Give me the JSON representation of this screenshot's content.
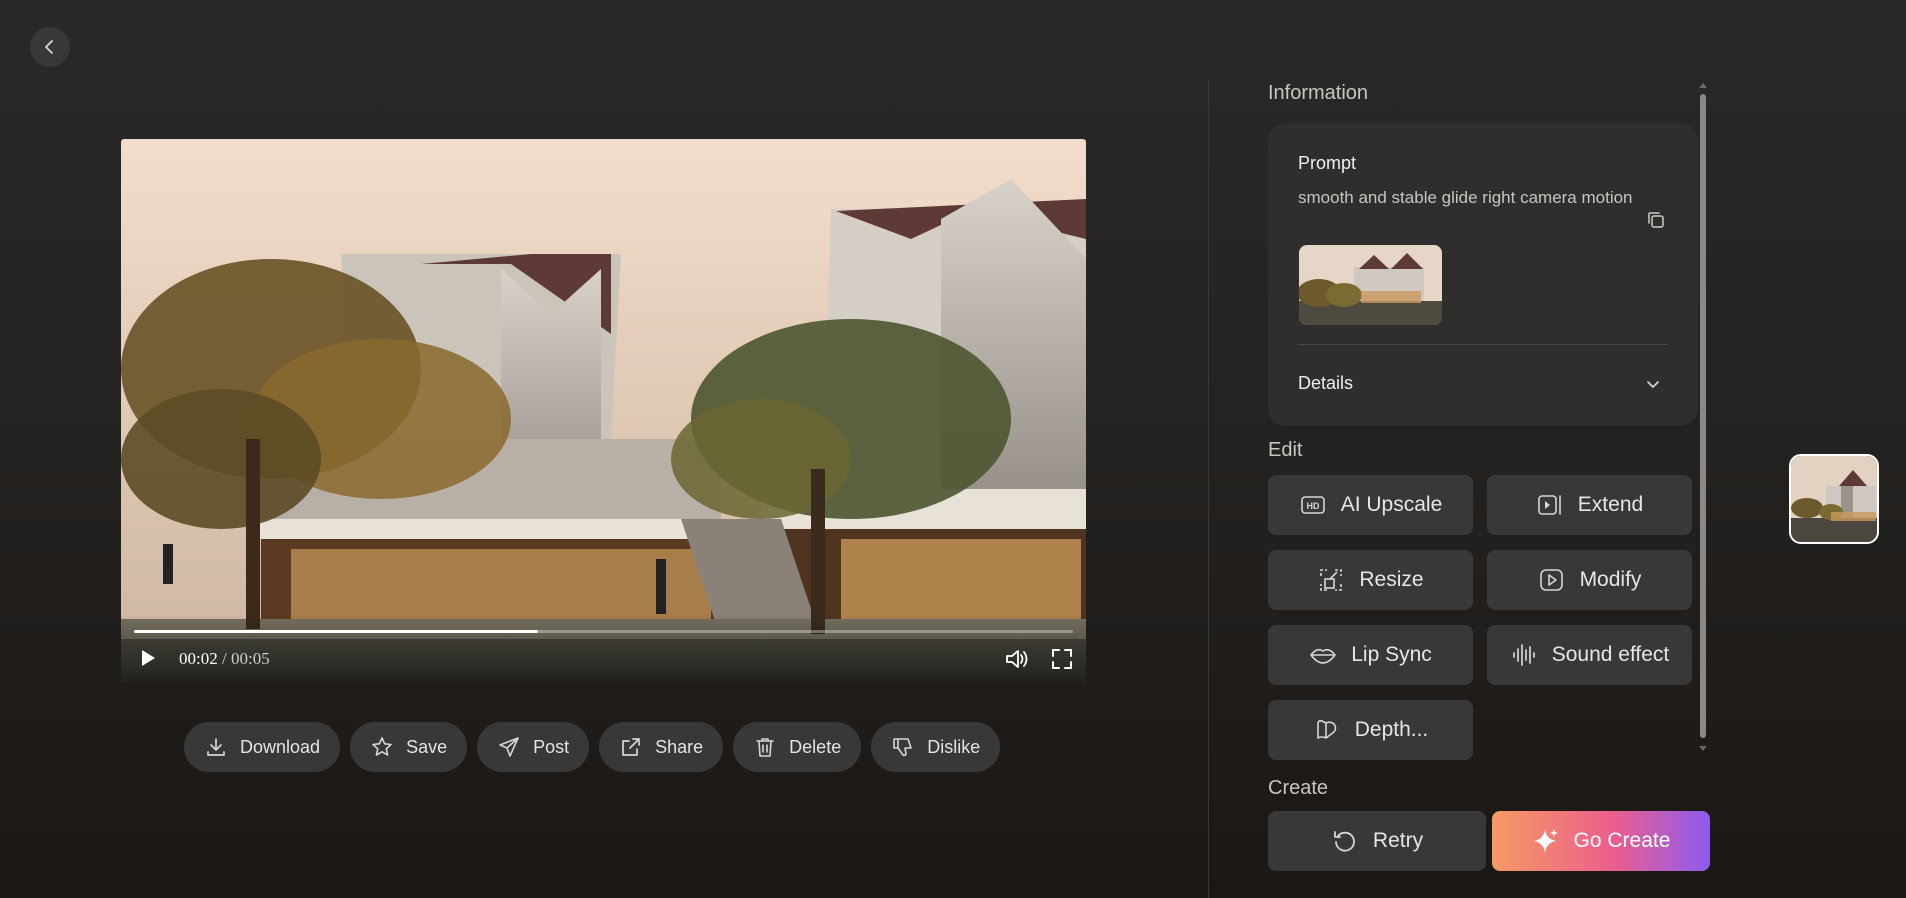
{
  "nav": {
    "back_icon": "chevron-left-icon"
  },
  "player": {
    "current_time": "00:02",
    "separator": " / ",
    "total_time": "00:05",
    "progress": 0.43,
    "icons": [
      "play-icon",
      "volume-icon",
      "fullscreen-icon"
    ]
  },
  "actions": [
    {
      "id": "download",
      "label": "Download",
      "icon": "download-icon"
    },
    {
      "id": "save",
      "label": "Save",
      "icon": "star-icon"
    },
    {
      "id": "post",
      "label": "Post",
      "icon": "send-icon"
    },
    {
      "id": "share",
      "label": "Share",
      "icon": "share-icon"
    },
    {
      "id": "delete",
      "label": "Delete",
      "icon": "trash-icon"
    },
    {
      "id": "dislike",
      "label": "Dislike",
      "icon": "thumbs-down-icon"
    }
  ],
  "info": {
    "title": "Information",
    "prompt_label": "Prompt",
    "prompt_text": "smooth and stable glide right camera motion",
    "details_label": "Details"
  },
  "edit": {
    "title": "Edit",
    "buttons": [
      {
        "id": "ai-upscale",
        "label": "AI Upscale",
        "icon": "hd-icon"
      },
      {
        "id": "extend",
        "label": "Extend",
        "icon": "extend-icon"
      },
      {
        "id": "resize",
        "label": "Resize",
        "icon": "resize-icon"
      },
      {
        "id": "modify",
        "label": "Modify",
        "icon": "modify-video-icon"
      },
      {
        "id": "lip-sync",
        "label": "Lip Sync",
        "icon": "lips-icon"
      },
      {
        "id": "sound-effect",
        "label": "Sound effect",
        "icon": "sound-wave-icon"
      },
      {
        "id": "depth",
        "label": "Depth...",
        "icon": "depth-icon"
      }
    ]
  },
  "create": {
    "title": "Create",
    "retry_label": "Retry",
    "go_create_label": "Go Create"
  },
  "colors": {
    "background": "#242120",
    "button": "#3a3837",
    "card": "#302e2d",
    "gradient_start": "#f59a63",
    "gradient_mid": "#ec5f8c",
    "gradient_end": "#8c5bf0"
  }
}
